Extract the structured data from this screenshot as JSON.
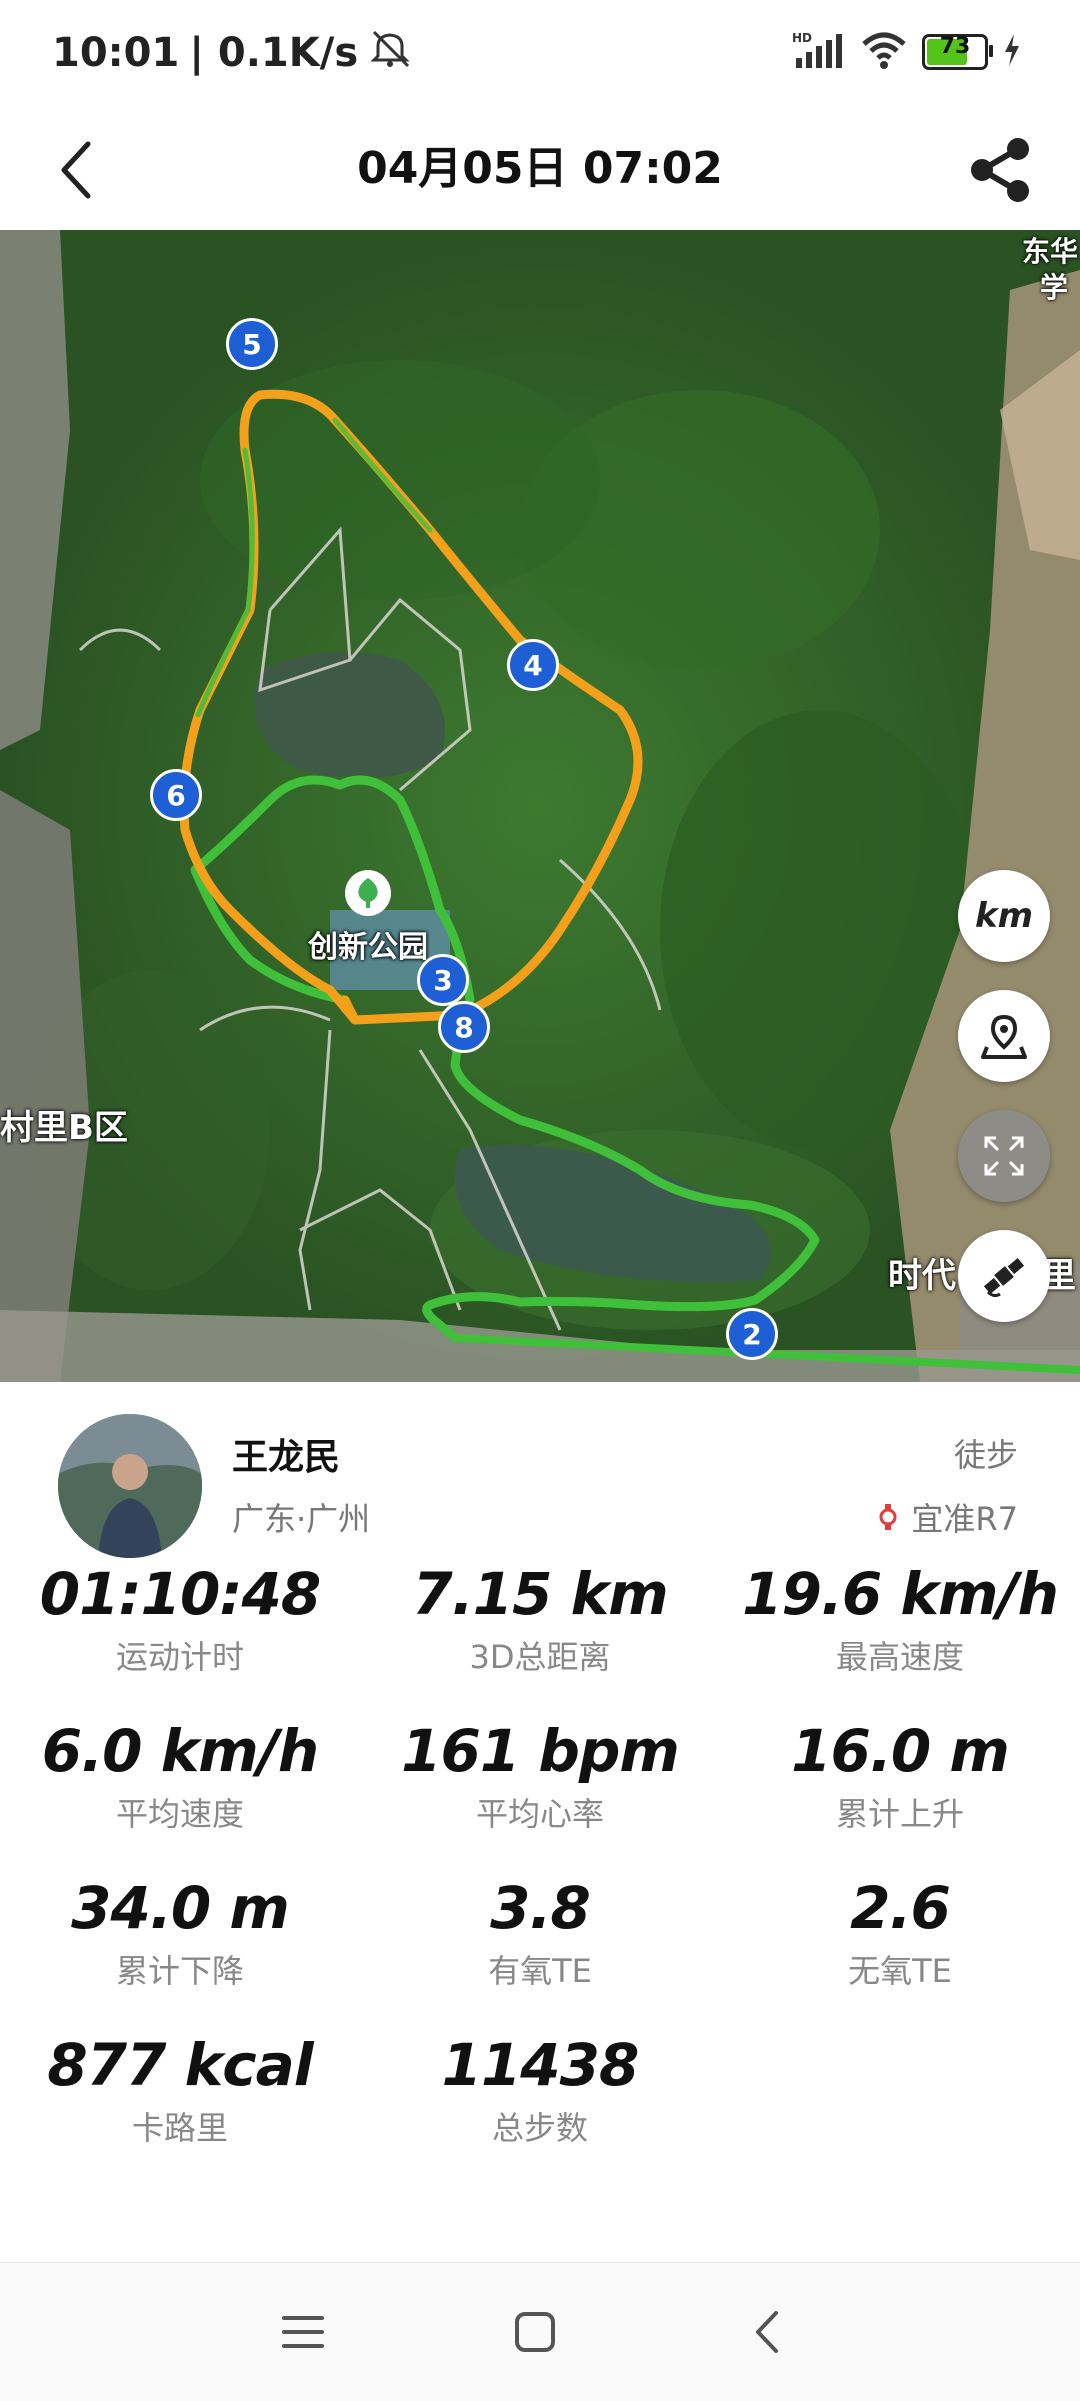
{
  "status_bar": {
    "time": "10:01",
    "net_speed": "| 0.1K/s",
    "battery": "73",
    "icons": [
      "mute-icon",
      "hd-signal-icon",
      "wifi-icon",
      "battery-icon",
      "charging-icon"
    ]
  },
  "header": {
    "title": "04月05日 07:02",
    "icons": [
      "back-arrow-icon",
      "share-icon"
    ]
  },
  "map": {
    "labels": {
      "park": "创新公园",
      "area_left": "村里B区",
      "area_right": "时代",
      "area_right2": "里",
      "top_right": "东华",
      "top_right2": "学"
    },
    "markers": [
      "5",
      "4",
      "6",
      "3",
      "8",
      "2"
    ],
    "controls": {
      "unit_button": "km"
    },
    "colors": {
      "route_green": "#3fbf3a",
      "route_orange": "#f5a01b",
      "marker_blue": "#1f5fd6"
    }
  },
  "profile": {
    "name": "王龙民",
    "location": "广东·广州",
    "sport": "徒步",
    "device": "宜准R7"
  },
  "stats": [
    {
      "value": "01:10:48",
      "label": "运动计时"
    },
    {
      "value": "7.15 km",
      "label": "3D总距离"
    },
    {
      "value": "19.6 km/h",
      "label": "最高速度"
    },
    {
      "value": "6.0 km/h",
      "label": "平均速度"
    },
    {
      "value": "161 bpm",
      "label": "平均心率"
    },
    {
      "value": "16.0 m",
      "label": "累计上升"
    },
    {
      "value": "34.0 m",
      "label": "累计下降"
    },
    {
      "value": "3.8",
      "label": "有氧TE"
    },
    {
      "value": "2.6",
      "label": "无氧TE"
    },
    {
      "value": "877 kcal",
      "label": "卡路里"
    },
    {
      "value": "11438",
      "label": "总步数"
    }
  ]
}
